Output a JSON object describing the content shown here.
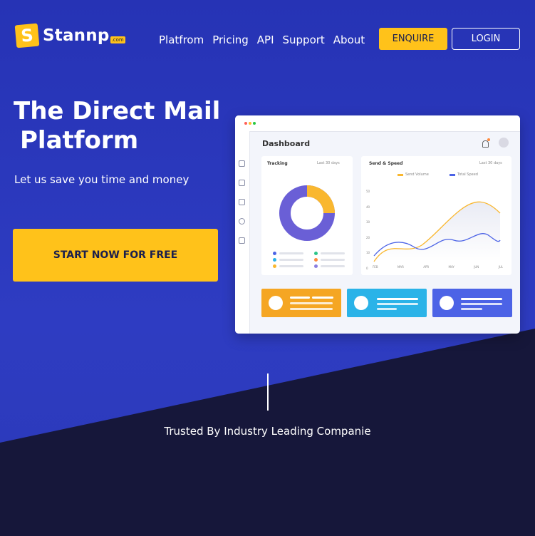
{
  "brand": {
    "logo_letter": "S",
    "name": "Stannp",
    "domain_suffix": ".com",
    "accent": "#ffc21a"
  },
  "nav": {
    "items": [
      "Platfrom",
      "Pricing",
      "API",
      "Support",
      "About"
    ]
  },
  "header": {
    "enquire_label": "ENQUIRE",
    "login_label": "LOGIN"
  },
  "hero": {
    "title_line1": "The Direct Mail",
    "title_line2": "Platform",
    "subtitle": "Let us save you time and money",
    "cta_label": "START NOW FOR FREE"
  },
  "dashboard": {
    "title": "Dashboard",
    "tracking": {
      "title": "Tracking",
      "range": "Last 30 days"
    },
    "send_speed": {
      "title": "Send & Speed",
      "range": "Last 30 days",
      "legend": [
        "Send Volume",
        "Total Speed"
      ],
      "y_ticks": [
        "50",
        "40",
        "30",
        "20",
        "10",
        "0"
      ],
      "x_ticks": [
        "FEB",
        "MAR",
        "APR",
        "MAY",
        "JUN",
        "JUL"
      ]
    },
    "tiles": [
      {
        "color": "#f5a623"
      },
      {
        "color": "#2ab3e8"
      },
      {
        "color": "#4c63e6"
      }
    ]
  },
  "trusted": {
    "text": "Trusted By Industry Leading Companie"
  }
}
